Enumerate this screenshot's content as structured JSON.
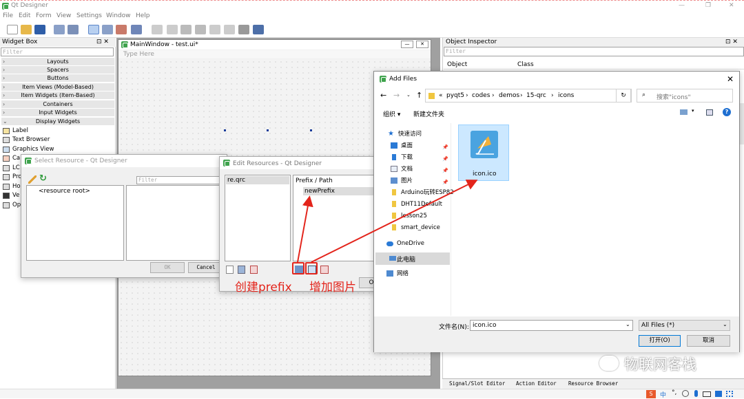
{
  "app": {
    "title": "Qt Designer",
    "menu": [
      "File",
      "Edit",
      "Form",
      "View",
      "Settings",
      "Window",
      "Help"
    ],
    "window_controls": [
      "—",
      "❐",
      "✕"
    ]
  },
  "widget_box": {
    "title": "Widget Box",
    "dock_controls": "⊡ ✕",
    "filter_placeholder": "Filter",
    "categories": [
      "Layouts",
      "Spacers",
      "Buttons",
      "Item Views (Model-Based)",
      "Item Widgets (Item-Based)",
      "Containers",
      "Input Widgets",
      "Display Widgets"
    ],
    "items": [
      "Label",
      "Text Browser",
      "Graphics View",
      "Ca",
      "LC",
      "Pro",
      "Ho",
      "Ve",
      "Op"
    ]
  },
  "main_window": {
    "title": "MainWindow - test.ui*",
    "type_here": "Type Here",
    "controls": [
      "—",
      "✕"
    ]
  },
  "object_inspector": {
    "title": "Object Inspector",
    "dock_controls": "⊡ ✕",
    "filter_placeholder": "Filter",
    "col_object": "Object",
    "col_class": "Class"
  },
  "bottom_tabs": [
    "Signal/Slot Editor",
    "Action Editor",
    "Resource Browser"
  ],
  "select_resource": {
    "title": "Select Resource - Qt Designer",
    "filter_placeholder": "Filter",
    "root": "<resource root>",
    "ok": "OK",
    "cancel": "Cancel"
  },
  "edit_resources": {
    "title": "Edit Resources - Qt Designer",
    "file": "re.qrc",
    "prefix_header": "Prefix / Path",
    "prefix": "newPrefix",
    "ok_partial": "O"
  },
  "annotations": {
    "create_prefix": "创建prefix",
    "add_image": "增加图片"
  },
  "add_files": {
    "title": "Add Files",
    "path": [
      "«",
      "pyqt5",
      "codes",
      "demos",
      "15-qrc",
      "icons"
    ],
    "search_placeholder": "搜索\"icons\"",
    "organize": "组织 ▾",
    "new_folder": "新建文件夹",
    "sidebar": {
      "quick_access": "快速访问",
      "desktop": "桌面",
      "downloads": "下载",
      "documents": "文档",
      "pictures": "图片",
      "folders": [
        "Arduino玩转ESP82",
        "DHT11Default",
        "lesson25",
        "smart_device"
      ],
      "onedrive": "OneDrive",
      "this_pc": "此电脑",
      "network": "网络"
    },
    "file_name": "icon.ico",
    "filename_label": "文件名(N):",
    "filename_value": "icon.ico",
    "filter_value": "All Files (*)",
    "open": "打开(O)",
    "cancel": "取消"
  },
  "watermark": "物联网客栈",
  "colors": {
    "accent_red": "#e3241b",
    "qt_green": "#3fa34d",
    "selection_blue": "#cce8ff"
  }
}
